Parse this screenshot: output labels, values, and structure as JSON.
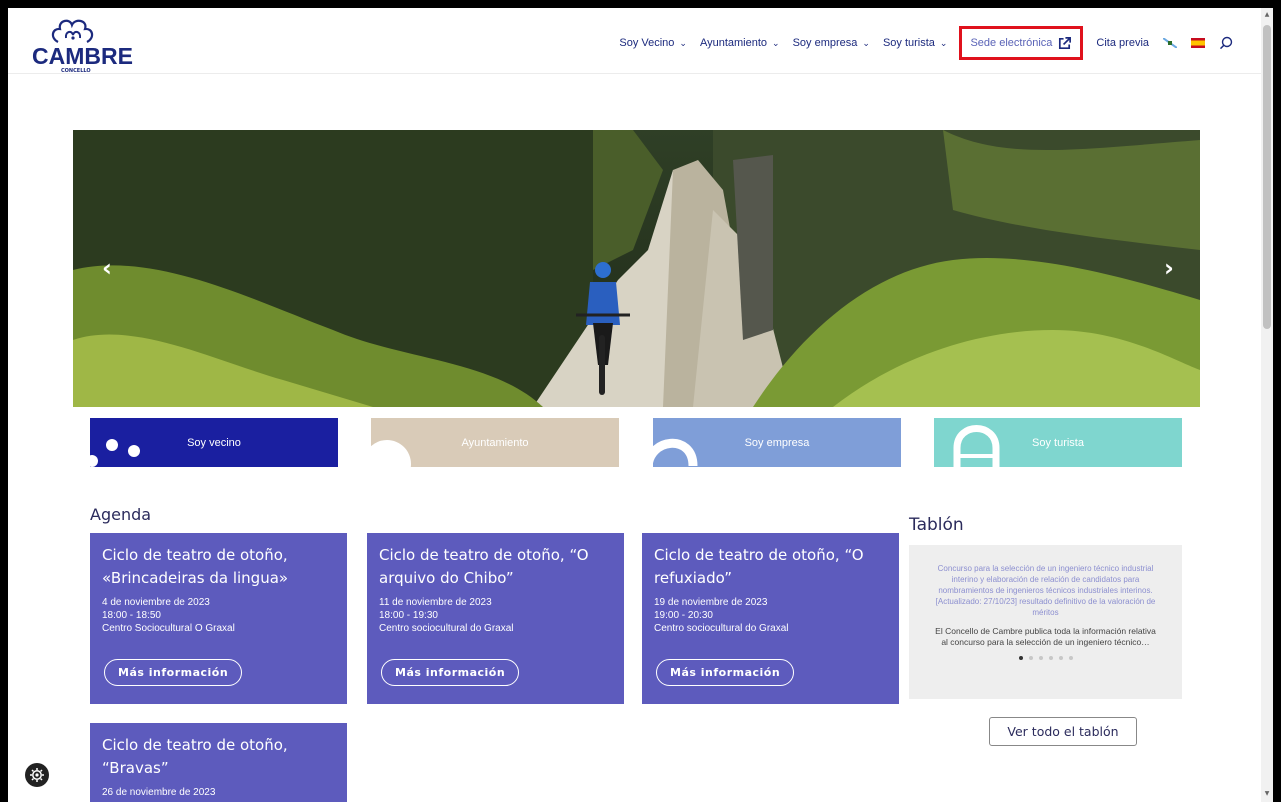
{
  "logo": {
    "name": "CAMBRE",
    "sub": "CONCELLO"
  },
  "nav": {
    "items": [
      {
        "label": "Soy Vecino"
      },
      {
        "label": "Ayuntamiento"
      },
      {
        "label": "Soy empresa"
      },
      {
        "label": "Soy turista"
      }
    ],
    "sede": "Sede electrónica",
    "cita": "Cita previa"
  },
  "tiles": [
    {
      "label": "Soy vecino",
      "color": "#1a1fa0"
    },
    {
      "label": "Ayuntamiento",
      "color": "#d9cbb8"
    },
    {
      "label": "Soy empresa",
      "color": "#7f9ed8"
    },
    {
      "label": "Soy turista",
      "color": "#7fd6cf"
    }
  ],
  "agenda": {
    "title": "Agenda",
    "button": "Más información",
    "events": [
      {
        "title": "Ciclo de teatro de otoño, «Brincadeiras da lingua»",
        "date": "4 de noviembre de 2023",
        "time": "18:00 - 18:50",
        "place": "Centro Sociocultural O Graxal"
      },
      {
        "title": "Ciclo de teatro de otoño, “O arquivo do Chibo”",
        "date": "11 de noviembre de 2023",
        "time": "18:00 - 19:30",
        "place": "Centro sociocultural do Graxal"
      },
      {
        "title": "Ciclo de teatro de otoño, “O refuxiado”",
        "date": "19 de noviembre de 2023",
        "time": "19:00 - 20:30",
        "place": "Centro sociocultural do Graxal"
      },
      {
        "title": "Ciclo de teatro de otoño, “Bravas”",
        "date": "26 de noviembre de 2023"
      }
    ]
  },
  "tablon": {
    "title": "Tablón",
    "headline": "Concurso para la selección de un ingeniero técnico industrial interino y elaboración de relación de candidatos para nombramientos de ingenieros técnicos industriales interinos. [Actualizado: 27/10/23] resultado definitivo de la valoración de méritos",
    "body": "El Concello de Cambre publica toda la información relativa al concurso para la selección de un ingeniero técnico…",
    "button": "Ver todo el tablón",
    "slide_count": 6,
    "active_slide": 1
  },
  "colors": {
    "brand": "#1c2a7e",
    "card": "#5d5bbd",
    "highlight": "#e0111c"
  }
}
